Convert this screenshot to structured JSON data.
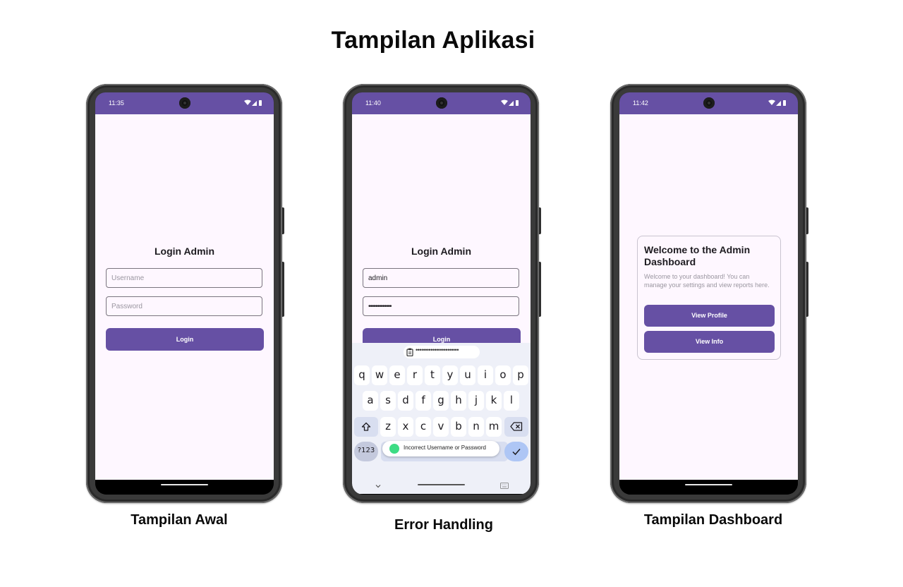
{
  "page": {
    "title": "Tampilan Aplikasi"
  },
  "phones": [
    {
      "caption": "Tampilan Awal",
      "time": "11:35",
      "login_title": "Login Admin",
      "username_placeholder": "Username",
      "password_placeholder": "Password",
      "login_label": "Login"
    },
    {
      "caption": "Error Handling",
      "time": "11:40",
      "login_title": "Login Admin",
      "username_value": "admin",
      "password_value": "•••••••••••••",
      "login_label": "Login",
      "clipboard_text": "•••••••••••••••••••••••",
      "keyboard": {
        "row1": [
          "q",
          "w",
          "e",
          "r",
          "t",
          "y",
          "u",
          "i",
          "o",
          "p"
        ],
        "row2": [
          "a",
          "s",
          "d",
          "f",
          "g",
          "h",
          "j",
          "k",
          "l"
        ],
        "row3": [
          "z",
          "x",
          "c",
          "v",
          "b",
          "n",
          "m"
        ],
        "symbols_label": "?123"
      },
      "toast_text": "Incorrect Username or Password"
    },
    {
      "caption": "Tampilan Dashboard",
      "time": "11:42",
      "card_title": "Welcome to the Admin Dashboard",
      "card_text": "Welcome to your dashboard! You can manage your settings and view reports here.",
      "view_profile_label": "View Profile",
      "view_info_label": "View Info"
    }
  ],
  "colors": {
    "primary": "#6650a4",
    "background": "#fef7ff",
    "keyboard": "#eef0f8"
  }
}
